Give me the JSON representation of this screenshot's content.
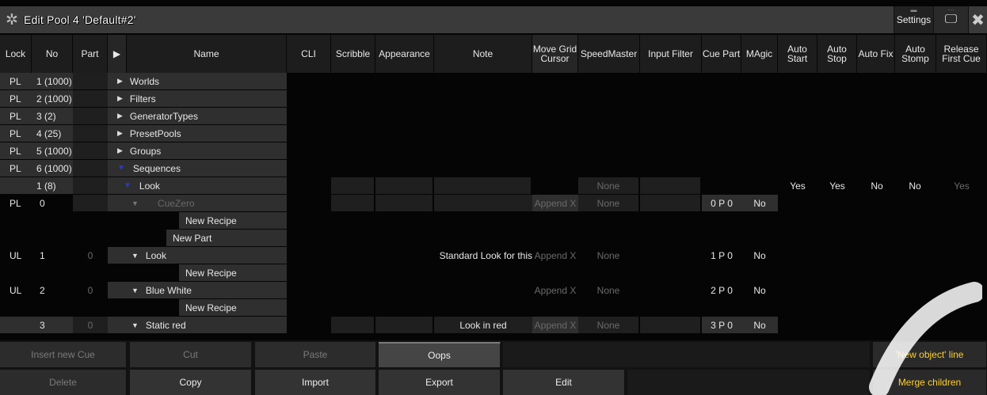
{
  "title": {
    "text": "Edit Pool 4 'Default#2'",
    "settings": "Settings"
  },
  "columns": [
    "Lock",
    "No",
    "Part",
    "▶",
    "Name",
    "CLI",
    "Scribble",
    "Appearance",
    "Note",
    "Move Grid Cursor",
    "SpeedMaster",
    "Input Filter",
    "Cue Part",
    "MAgic",
    "Auto Start",
    "Auto Stop",
    "Auto Fix",
    "Auto Stomp",
    "Release First Cue"
  ],
  "rows": [
    {
      "lock": "PL",
      "no": "1 (1000)",
      "name": "Worlds"
    },
    {
      "lock": "PL",
      "no": "2 (1000)",
      "name": "Filters"
    },
    {
      "lock": "PL",
      "no": "3 (2)",
      "name": "GeneratorTypes"
    },
    {
      "lock": "PL",
      "no": "4 (25)",
      "name": "PresetPools"
    },
    {
      "lock": "PL",
      "no": "5 (1000)",
      "name": "Groups"
    },
    {
      "lock": "PL",
      "no": "6 (1000)",
      "name": "Sequences"
    },
    {
      "no": "1 (8)",
      "name": "Look",
      "speed": "None",
      "autostart": "Yes",
      "autostop": "Yes",
      "autofix": "No",
      "autostomp": "No",
      "release": "Yes"
    },
    {
      "lock": "PL",
      "no": "0",
      "name": "CueZero",
      "move": "Append X",
      "speed": "None",
      "cuepart": "0 P 0",
      "magic": "No"
    },
    {
      "name": "New Recipe"
    },
    {
      "name": "New Part"
    },
    {
      "lock": "UL",
      "no": "1",
      "part": "0",
      "name": "Look",
      "note": "Standard Look for this",
      "move": "Append X",
      "speed": "None",
      "cuepart": "1 P 0",
      "magic": "No"
    },
    {
      "name": "New Recipe"
    },
    {
      "lock": "UL",
      "no": "2",
      "part": "0",
      "name": "Blue White",
      "move": "Append X",
      "speed": "None",
      "cuepart": "2 P 0",
      "magic": "No"
    },
    {
      "name": "New Recipe"
    },
    {
      "no": "3",
      "part": "0",
      "name": "Static red",
      "note": "Look in red",
      "move": "Append X",
      "speed": "None",
      "cuepart": "3 P 0",
      "magic": "No"
    }
  ],
  "buttons": {
    "insert": "Insert new Cue",
    "cut": "Cut",
    "paste": "Paste",
    "oops": "Oops",
    "newobj": "'New object' line",
    "delete": "Delete",
    "copy": "Copy",
    "import": "Import",
    "export": "Export",
    "edit": "Edit",
    "merge": "Merge children"
  },
  "colors": {
    "accent": "#ffcf2e",
    "tree_arrow": "#2c3cc0"
  }
}
